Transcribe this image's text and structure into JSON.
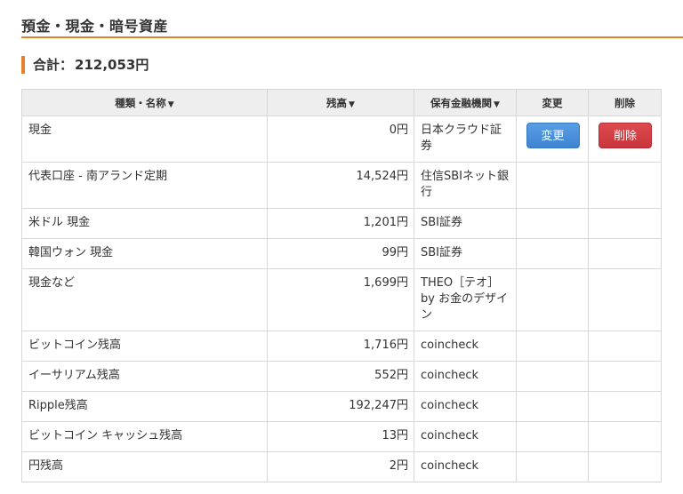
{
  "header": {
    "title": "預金・現金・暗号資産"
  },
  "total": {
    "label": "合計：",
    "value": "212,053円"
  },
  "table": {
    "columns": {
      "name": "種類・名称",
      "balance": "残高",
      "institution": "保有金融機関",
      "edit": "変更",
      "delete": "削除"
    },
    "sort_indicator": "▼",
    "rows": [
      {
        "name": "現金",
        "balance": "0円",
        "institution": "日本クラウド証券",
        "has_actions": true
      },
      {
        "name": "代表口座 - 南アランド定期",
        "balance": "14,524円",
        "institution": "住信SBIネット銀行"
      },
      {
        "name": "米ドル 現金",
        "balance": "1,201円",
        "institution": "SBI証券"
      },
      {
        "name": "韓国ウォン 現金",
        "balance": "99円",
        "institution": "SBI証券"
      },
      {
        "name": "現金など",
        "balance": "1,699円",
        "institution": "THEO［テオ］by お金のデザイン"
      },
      {
        "name": "ビットコイン残高",
        "balance": "1,716円",
        "institution": "coincheck"
      },
      {
        "name": "イーサリアム残高",
        "balance": "552円",
        "institution": "coincheck"
      },
      {
        "name": "Ripple残高",
        "balance": "192,247円",
        "institution": "coincheck"
      },
      {
        "name": "ビットコイン キャッシュ残高",
        "balance": "13円",
        "institution": "coincheck"
      },
      {
        "name": "円残高",
        "balance": "2円",
        "institution": "coincheck"
      }
    ],
    "buttons": {
      "edit": "変更",
      "delete": "削除"
    }
  },
  "colors": {
    "accent": "#e3812d",
    "edit_button": "#4a90e2",
    "delete_button": "#d0393e",
    "header_bg": "#eeeeee"
  }
}
